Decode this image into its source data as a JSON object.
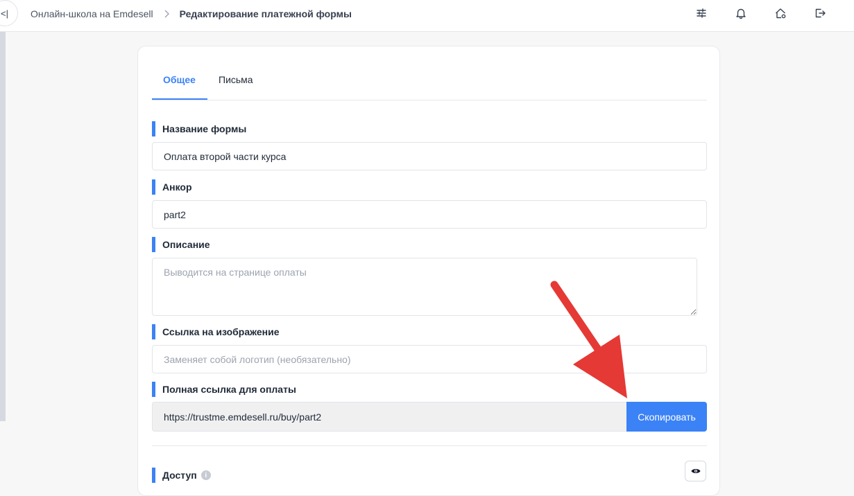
{
  "header": {
    "collapse_glyph": "<|",
    "breadcrumb": {
      "parent": "Онлайн-школа на Emdesell",
      "current": "Редактирование платежной формы"
    },
    "icons": [
      "sliders-icon",
      "bell-icon",
      "home-settings-icon",
      "logout-icon"
    ]
  },
  "tabs": [
    {
      "label": "Общее",
      "active": true
    },
    {
      "label": "Письма",
      "active": false
    }
  ],
  "form": {
    "name": {
      "label": "Название формы",
      "value": "Оплата второй части курса"
    },
    "anchor": {
      "label": "Анкор",
      "value": "part2"
    },
    "description": {
      "label": "Описание",
      "placeholder": "Выводится на странице оплаты"
    },
    "image_link": {
      "label": "Ссылка на изображение",
      "placeholder": "Заменяет собой логотип (необязательно)"
    },
    "payment_link": {
      "label": "Полная ссылка для оплаты",
      "value": "https://trustme.emdesell.ru/buy/part2",
      "copy_label": "Скопировать"
    },
    "access": {
      "label": "Доступ",
      "info_glyph": "i"
    }
  },
  "colors": {
    "accent": "#3b82f6",
    "annotation_arrow": "#e53935"
  }
}
